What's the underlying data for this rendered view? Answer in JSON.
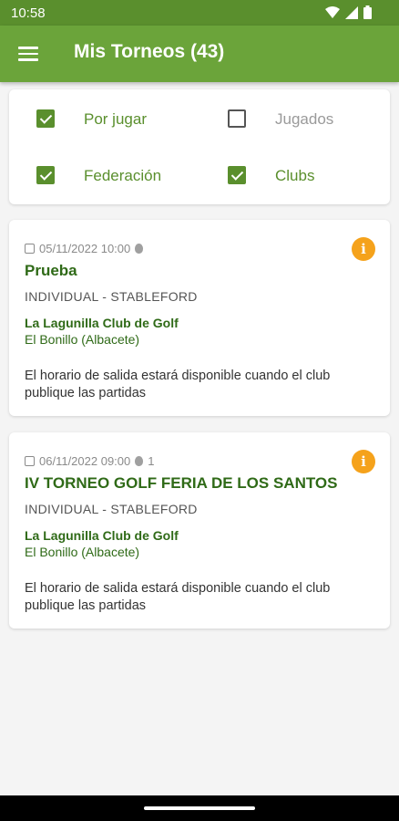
{
  "status_bar": {
    "time": "10:58",
    "icons": [
      "wifi-icon",
      "signal-icon",
      "battery-icon"
    ]
  },
  "app_bar": {
    "title": "Mis Torneos (43)",
    "menu_icon": "menu-icon"
  },
  "filters": [
    {
      "label": "Por jugar",
      "checked": true
    },
    {
      "label": "Jugados",
      "checked": false
    },
    {
      "label": "Federación",
      "checked": true
    },
    {
      "label": "Clubs",
      "checked": true
    }
  ],
  "tournaments": [
    {
      "datetime": "05/11/2022 10:00",
      "players": "",
      "name": "Prueba",
      "modality": "INDIVIDUAL - STABLEFORD",
      "club": "La Lagunilla Club de Golf",
      "location": "El Bonillo (Albacete)",
      "notice": "El horario de salida estará disponible cuando el club publique las partidas"
    },
    {
      "datetime": "06/11/2022 09:00",
      "players": "1",
      "name": "IV TORNEO GOLF FERIA DE LOS SANTOS",
      "modality": "INDIVIDUAL - STABLEFORD",
      "club": "La Lagunilla Club de Golf",
      "location": "El Bonillo (Albacete)",
      "notice": "El horario de salida estará disponible cuando el club publique las partidas"
    }
  ],
  "colors": {
    "primary": "#6ba43a",
    "status_bar": "#5a8f2d",
    "text_green": "#2f6a17",
    "info": "#f5a21b"
  }
}
